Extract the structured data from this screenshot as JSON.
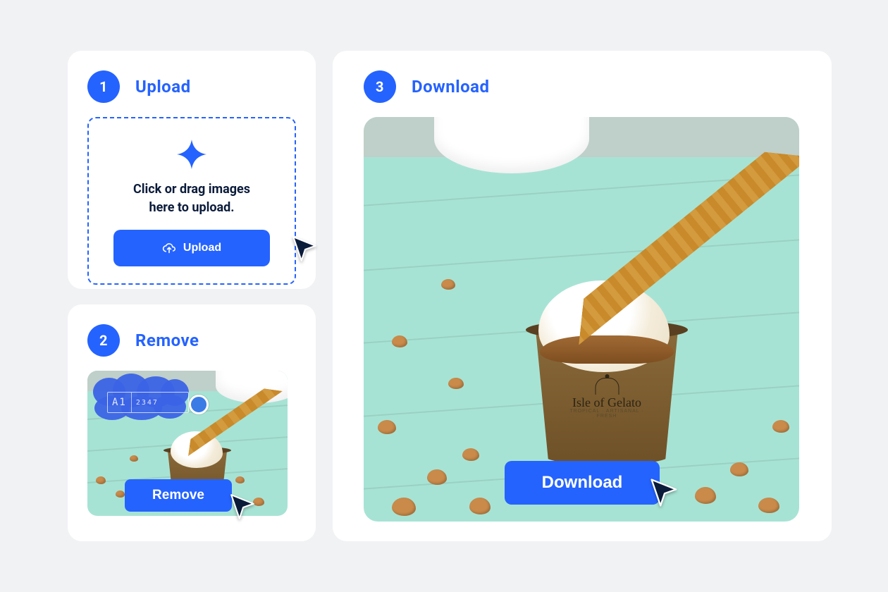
{
  "steps": {
    "upload": {
      "num": "1",
      "title": "Upload"
    },
    "remove": {
      "num": "2",
      "title": "Remove"
    },
    "download": {
      "num": "3",
      "title": "Download"
    }
  },
  "dropzone": {
    "line1": "Click or drag images",
    "line2": "here to upload."
  },
  "buttons": {
    "upload": "Upload",
    "remove": "Remove",
    "download": "Download"
  },
  "cup": {
    "brand": "Isle of Gelato",
    "tagline": "TROPICAL · ARTISANAL · FRESH"
  },
  "watermark": {
    "left": "A1",
    "right": "2347"
  }
}
